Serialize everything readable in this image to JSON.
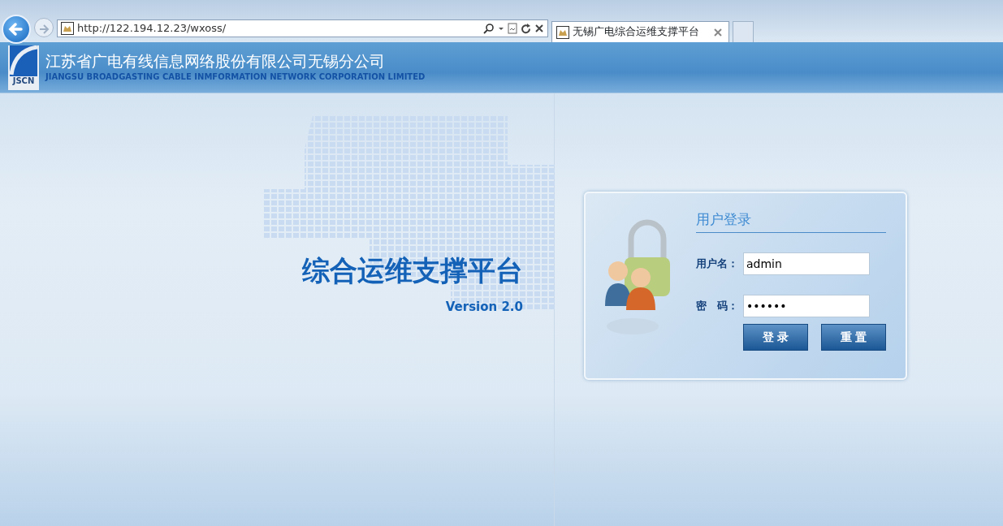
{
  "browser": {
    "address": "http://122.194.12.23/wxoss/",
    "tabs": [
      {
        "label": "无锡广电综合运维支撑平台",
        "selected": true
      }
    ]
  },
  "header": {
    "logo_text": "JSCN",
    "title": "江苏省广电有线信息网络股份有限公司无锡分公司",
    "subtitle": "JIANGSU BROADGASTING CABLE INMFORMATION NETWORK CORPORATION LIMITED"
  },
  "hero": {
    "title": "综合运维支撑平台",
    "version": "Version 2.0"
  },
  "login": {
    "title": "用户登录",
    "fields": [
      {
        "label": "用户名：",
        "value": "admin"
      },
      {
        "label": "密　码：",
        "value": "••••••"
      }
    ],
    "buttons": [
      "登 录",
      "重 置"
    ]
  }
}
